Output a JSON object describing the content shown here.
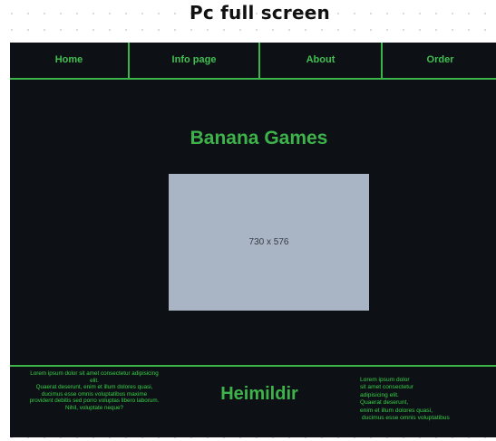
{
  "page_title": "Pc full screen",
  "nav": {
    "items": [
      {
        "label": "Home"
      },
      {
        "label": "Info page"
      },
      {
        "label": "About"
      },
      {
        "label": "Order"
      }
    ]
  },
  "hero": {
    "title": "Banana Games",
    "image_placeholder": "730 x 576"
  },
  "footer": {
    "left_lines": [
      "Lorem ipsum dolor sit amet consectetur adipisicing",
      "elit.",
      "Quaerat deserunt, enim et illum dolores quasi,",
      "ducimus esse omnis voluptatibus maxime",
      "provident debitis sed porro voluptas libero laborum.",
      "Nihil, voluptate neque?"
    ],
    "title": "Heimildir",
    "right_lines": [
      "Lorem ipsum dolor",
      "sit amet consectetur",
      "adipisicing elit.",
      "Quaerat deserunt,",
      "enim et illum dolores quasi,",
      "ducimus esse omnis voluptatibus"
    ]
  },
  "colors": {
    "frame_background": "#0d1116",
    "accent_green": "#3fb34b",
    "placeholder_fill": "#a9b4c4",
    "page_background": "#ffffff"
  }
}
